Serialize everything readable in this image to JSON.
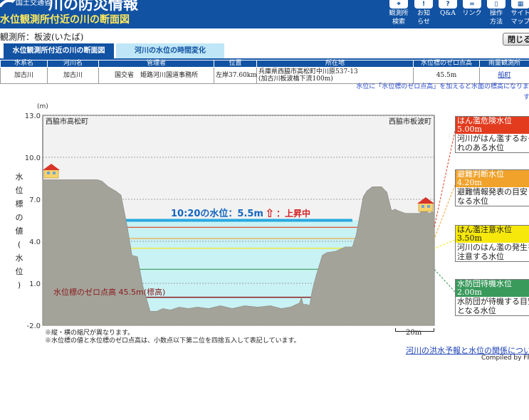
{
  "header": {
    "ministry": "国土交通省",
    "title": "川の防災情報",
    "subtitle": "水位観測所付近の川の断面図",
    "buttons": [
      {
        "label": "観測所\n検索",
        "icon": "map-pin-icon"
      },
      {
        "label": "お知\nらせ",
        "icon": "info-icon"
      },
      {
        "label": "Q&A",
        "icon": "question-icon"
      },
      {
        "label": "リンク",
        "icon": "link-icon"
      },
      {
        "label": "操作\n方法",
        "icon": "book-icon"
      },
      {
        "label": "サイト\nマップ",
        "icon": "sitemap-icon"
      }
    ]
  },
  "station": {
    "label": "観測所：板波(いたば)"
  },
  "close_label": "閉じる",
  "tabs": [
    {
      "label": "水位観測所付近の川の断面図",
      "active": true
    },
    {
      "label": "河川の水位の時間変化",
      "active": false
    }
  ],
  "table": {
    "headers": [
      "水系名",
      "河川名",
      "管理者",
      "位置",
      "所在地",
      "水位標のゼロ点高",
      "雨量観測所"
    ],
    "row": {
      "system": "加古川",
      "river": "加古川",
      "manager": "国交省　姫路河川国道事務所",
      "position": "左岸37.60km",
      "address1": "兵庫県西脇市高松町中川原537-13",
      "address2": "(加古川板波橋下流100m)",
      "zero_height": "45.5m",
      "rain_station": "船町"
    }
  },
  "note_top": "水位に「水位標のゼロ点高」を加えると水面の標高になりま",
  "note_top_tail": "す",
  "chart_data": {
    "type": "area",
    "ylabel": "水位標の値(水位)",
    "yunit": "(m)",
    "y_ticks": [
      13.0,
      10.0,
      7.0,
      4.0,
      1.0,
      -2.0
    ],
    "ylim": [
      -2.0,
      13.0
    ],
    "left_bank_label": "西脇市高松町",
    "right_bank_label": "西脇市板波町",
    "current_time": "10:20",
    "current_level_label": "10:20の水位：5.5m",
    "current_level": 5.5,
    "trend_label": "上昇中",
    "zero_point_label": "水位標のゼロ点高 45.5m(標高)",
    "thresholds": [
      {
        "name": "はん濫危険水位",
        "value": 5.0,
        "value_label": "5.00m",
        "desc": [
          "河川がはん濫するおそ",
          "れのある水位"
        ],
        "color": "#e23b1e"
      },
      {
        "name": "避難判断水位",
        "value": 4.2,
        "value_label": "4.20m",
        "desc": [
          "避難情報発表の目安と",
          "なる水位"
        ],
        "color": "#f0a22a"
      },
      {
        "name": "はん濫注意水位",
        "value": 3.5,
        "value_label": "3.50m",
        "desc": [
          "河川のはん濫の発生を",
          "注意する水位"
        ],
        "color": "#f6e80a"
      },
      {
        "name": "水防団待機水位",
        "value": 2.0,
        "value_label": "2.00m",
        "desc": [
          "水防団が待機する目安",
          "となる水位"
        ],
        "color": "#3a9a5c"
      }
    ],
    "cross_section_profile": [
      [
        0,
        8.4
      ],
      [
        30,
        8.4
      ],
      [
        60,
        8.4
      ],
      [
        65,
        8.3
      ],
      [
        72,
        7.9
      ],
      [
        80,
        7.6
      ],
      [
        86,
        7.3
      ],
      [
        93,
        5.0
      ],
      [
        98,
        3.0
      ],
      [
        104,
        2.9
      ],
      [
        110,
        0.8
      ],
      [
        118,
        -1.0
      ],
      [
        125,
        -1.0
      ],
      [
        132,
        -0.8
      ],
      [
        140,
        -0.9
      ],
      [
        150,
        -0.7
      ],
      [
        160,
        -0.8
      ],
      [
        170,
        -0.7
      ],
      [
        182,
        -0.8
      ],
      [
        195,
        -0.6
      ],
      [
        208,
        -0.8
      ],
      [
        222,
        -0.6
      ],
      [
        236,
        -0.7
      ],
      [
        250,
        -0.6
      ],
      [
        262,
        -0.8
      ],
      [
        272,
        -0.7
      ],
      [
        282,
        -0.4
      ],
      [
        284,
        0.0
      ],
      [
        286,
        -0.5
      ],
      [
        290,
        -0.5
      ],
      [
        293,
        -0.6
      ],
      [
        296,
        0.5
      ],
      [
        300,
        1.5
      ],
      [
        307,
        3.0
      ],
      [
        312,
        3.2
      ],
      [
        322,
        3.3
      ],
      [
        332,
        3.6
      ],
      [
        340,
        3.6
      ],
      [
        344,
        4.4
      ],
      [
        348,
        5.8
      ],
      [
        352,
        7.2
      ],
      [
        356,
        7.6
      ],
      [
        362,
        7.9
      ],
      [
        372,
        7.9
      ],
      [
        378,
        7.5
      ],
      [
        383,
        6.2
      ],
      [
        387,
        6.3
      ],
      [
        390,
        6.2
      ],
      [
        398,
        6.0
      ],
      [
        406,
        6.0
      ],
      [
        414,
        6.0
      ],
      [
        418,
        6.4
      ],
      [
        424,
        6.0
      ],
      [
        428,
        6.1
      ],
      [
        430,
        6.0
      ]
    ],
    "scale_label": "20m"
  },
  "footnotes": [
    "※縦・横の縮尺が異なります。",
    "※水位標の値と水位標のゼロ点高は、小数点以下第二位を四捨五入して表記しています。"
  ],
  "bottom_link": "河川の洪水予報と水位の関係につい",
  "credit": "Compiled by FRIC"
}
